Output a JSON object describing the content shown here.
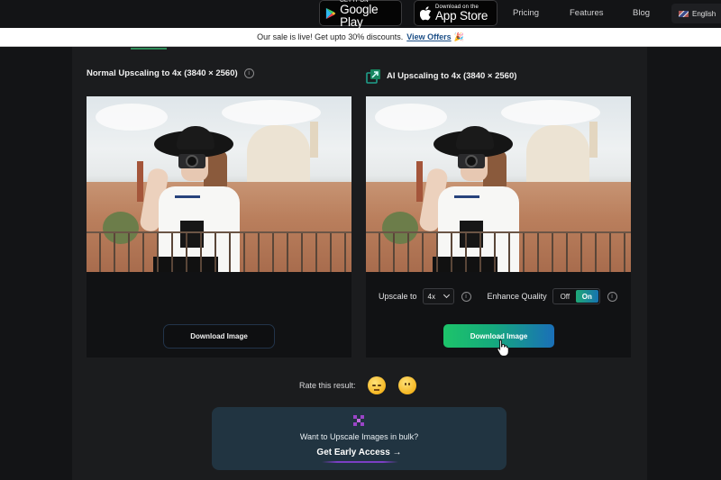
{
  "topnav": {
    "google_play": {
      "small": "GET IT ON",
      "big": "Google Play"
    },
    "app_store": {
      "small": "Download on the",
      "big": "App Store"
    },
    "links": [
      "Pricing",
      "Features",
      "Blog"
    ],
    "language": "English"
  },
  "banner": {
    "text": "Our sale is live! Get upto 30% discounts.",
    "link": "View Offers",
    "emoji": "🎉"
  },
  "cards": {
    "normal": {
      "title": "Normal Upscaling to 4x (3840 × 2560)",
      "info": "i",
      "download_label": "Download Image"
    },
    "ai": {
      "title": "AI Upscaling to 4x (3840 × 2560)",
      "upscale_label": "Upscale to",
      "upscale_value": "4x",
      "enhance_label": "Enhance Quality",
      "toggle_off": "Off",
      "toggle_on": "On",
      "toggle_state": "On",
      "info": "i",
      "download_label": "Download Image"
    }
  },
  "rating": {
    "label": "Rate this result:",
    "options": [
      "sad-face",
      "neutral-face"
    ]
  },
  "bulk": {
    "text": "Want to Upscale Images in bulk?",
    "cta": "Get Early Access →"
  },
  "colors": {
    "accent_green": "#1dc46a",
    "accent_blue": "#1a6fb8",
    "link_blue": "#1b4e86",
    "bulk_bg": "#213441",
    "purple": "#9b44c8"
  }
}
